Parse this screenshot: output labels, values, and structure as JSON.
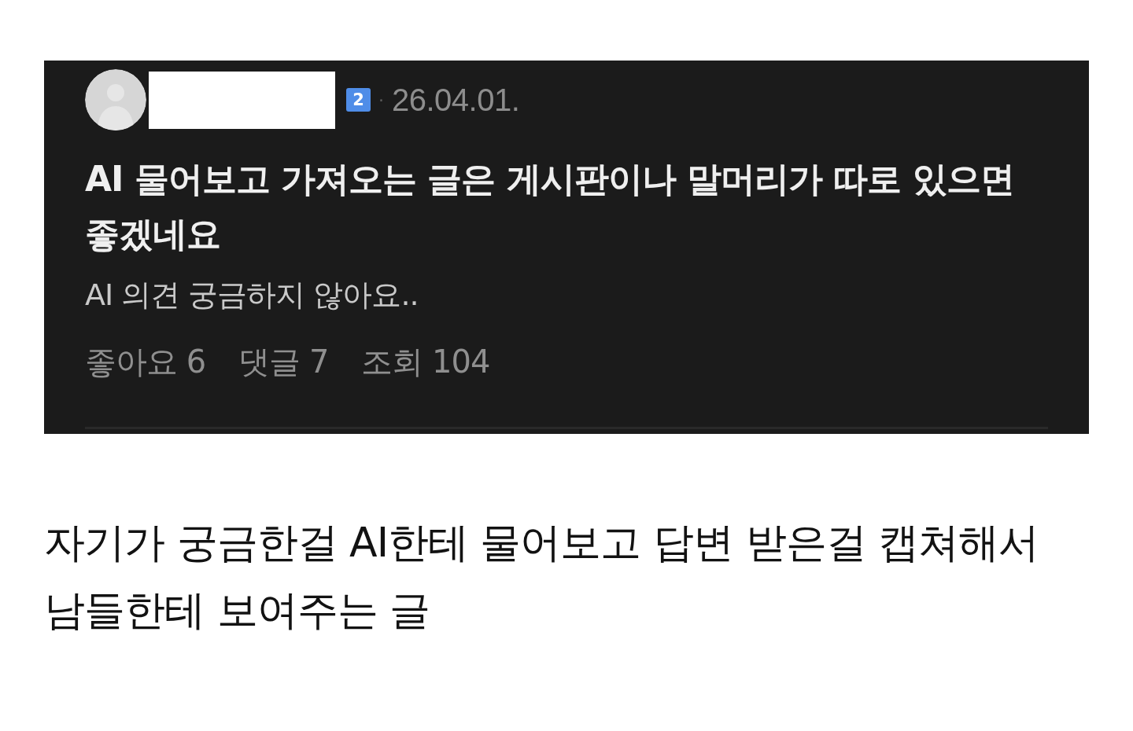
{
  "post": {
    "level_badge": "2",
    "separator": "·",
    "date": "26.04.01.",
    "title": "AI 물어보고 가져오는 글은 게시판이나 말머리가 따로 있으면 좋겠네요",
    "body": "AI 의견 궁금하지 않아요..",
    "stats": [
      "좋아요 6",
      "댓글 7",
      "조회 104"
    ]
  },
  "caption": "자기가 궁금한걸 AI한테 물어보고 답변 받은걸 캡쳐해서 남들한테 보여주는 글"
}
